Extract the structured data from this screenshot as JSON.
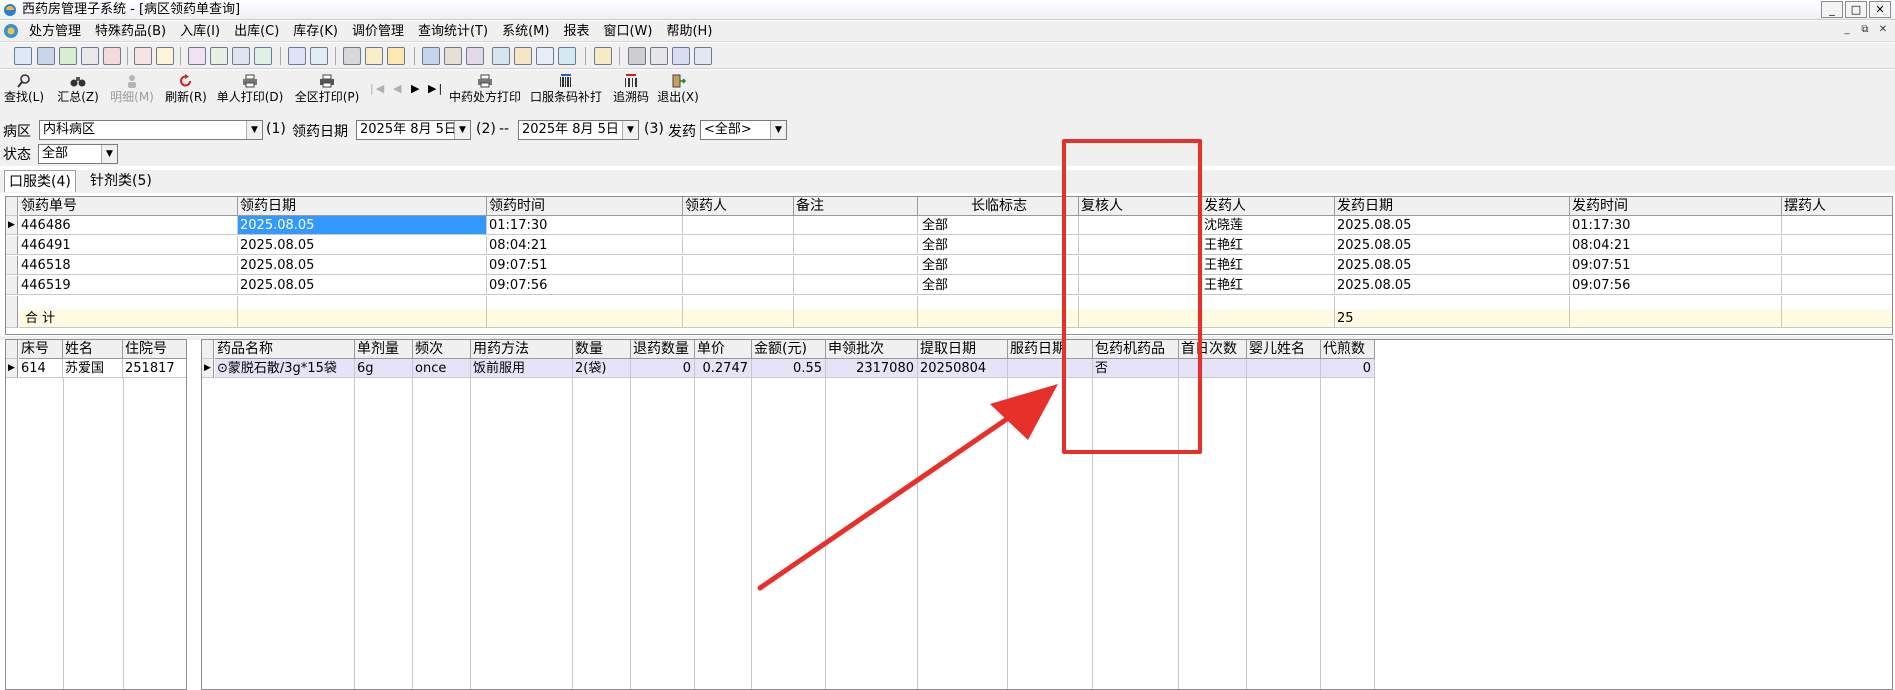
{
  "window": {
    "title": "西药房管理子系统 - [病区领药单查询]",
    "controls": [
      "_",
      "□",
      "✕"
    ]
  },
  "menubar": {
    "items": [
      "处方管理",
      "特殊药品(B)",
      "入库(I)",
      "出库(C)",
      "库存(K)",
      "调价管理",
      "查询统计(T)",
      "系统(M)",
      "报表",
      "窗口(W)",
      "帮助(H)"
    ],
    "mdi_controls": [
      "_",
      "⧉",
      "✕"
    ]
  },
  "toolbar2": {
    "find": "查找(L)",
    "summary": "汇总(Z)",
    "detail": "明细(M)",
    "refresh": "刷新(R)",
    "single_print": "单人打印(D)",
    "ward_print": "全区打印(P)",
    "herbal_print": "中药处方打印",
    "oral_barcode": "口服条码补打",
    "trace_code": "追溯码",
    "exit": "退出(X)"
  },
  "filters": {
    "ward_label": "病区",
    "ward_value": "内科病区",
    "step1": "(1)",
    "date_label": "领药日期",
    "date_from": "2025年  8月  5日",
    "step2": "(2)",
    "dash": "--",
    "date_to": "2025年  8月  5日",
    "step3": "(3)",
    "dispense_label": "发药",
    "dispense_value": "<全部>",
    "status_label": "状态",
    "status_value": "全部"
  },
  "tabs": [
    "口服类(4)",
    "针剂类(5)"
  ],
  "upper_grid": {
    "columns": [
      "领药单号",
      "领药日期",
      "领药时间",
      "领药人",
      "备注",
      "长临标志",
      "复核人",
      "发药人",
      "发药日期",
      "发药时间",
      "摆药人"
    ],
    "rows": [
      [
        "446486",
        "2025.08.05",
        "01:17:30",
        "",
        "",
        "全部",
        "",
        "沈晓莲",
        "2025.08.05",
        "01:17:30",
        ""
      ],
      [
        "446491",
        "2025.08.05",
        "08:04:21",
        "",
        "",
        "全部",
        "",
        "王艳红",
        "2025.08.05",
        "08:04:21",
        ""
      ],
      [
        "446518",
        "2025.08.05",
        "09:07:51",
        "",
        "",
        "全部",
        "",
        "王艳红",
        "2025.08.05",
        "09:07:51",
        ""
      ],
      [
        "446519",
        "2025.08.05",
        "09:07:56",
        "",
        "",
        "全部",
        "",
        "王艳红",
        "2025.08.05",
        "09:07:56",
        ""
      ]
    ],
    "total_label": "合    计",
    "total_value": "25"
  },
  "patient_grid": {
    "columns": [
      "床号",
      "姓名",
      "住院号"
    ],
    "rows": [
      [
        "614",
        "苏爱国",
        "251817"
      ]
    ]
  },
  "drug_grid": {
    "columns": [
      "药品名称",
      "单剂量",
      "频次",
      "用药方法",
      "数量",
      "退药数量",
      "单价",
      "金额(元)",
      "申领批次",
      "提取日期",
      "服药日期",
      "包药机药品",
      "首日次数",
      "婴儿姓名",
      "代煎数"
    ],
    "rows": [
      [
        "⊙蒙脱石散/3g*15袋",
        "6g",
        "once",
        "饭前服用",
        "2(袋)",
        "0",
        "0.2747",
        "0.55",
        "2317080",
        "20250804",
        "",
        "否",
        "",
        "",
        "0"
      ]
    ]
  },
  "colors": {
    "annotation": "#e8302a",
    "selection": "#3399ff",
    "summary_row": "#fffbe2",
    "highlight_row": "#e6e2f8"
  }
}
